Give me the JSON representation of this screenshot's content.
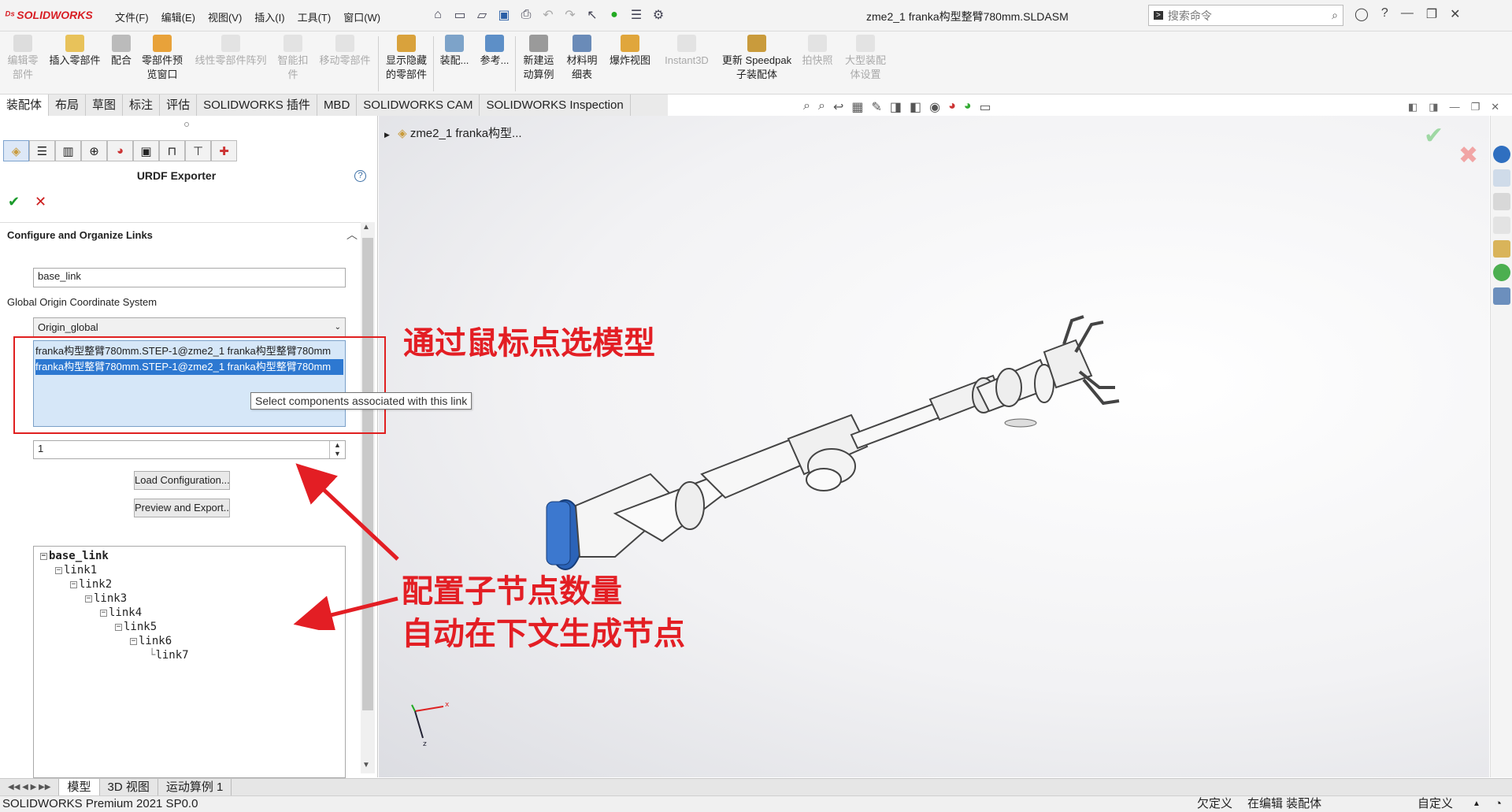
{
  "app": {
    "logo_text": "SOLIDWORKS"
  },
  "menus": [
    "文件(F)",
    "编辑(E)",
    "视图(V)",
    "插入(I)",
    "工具(T)",
    "窗口(W)"
  ],
  "window": {
    "title": "zme2_1 franka构型整臂780mm.SLDASM"
  },
  "search": {
    "placeholder": "搜索命令"
  },
  "commands": [
    {
      "label": "编辑零\n部件",
      "enabled": false
    },
    {
      "label": "插入零部件",
      "enabled": true
    },
    {
      "label": "配合",
      "enabled": true
    },
    {
      "label": "零部件预\n览窗口",
      "enabled": true
    },
    {
      "label": "线性零部件阵列",
      "enabled": false
    },
    {
      "label": "智能扣\n件",
      "enabled": false
    },
    {
      "label": "移动零部件",
      "enabled": false
    },
    {
      "label": "显示隐藏\n的零部件",
      "enabled": true
    },
    {
      "label": "装配...",
      "enabled": true
    },
    {
      "label": "参考...",
      "enabled": true
    },
    {
      "label": "新建运\n动算例",
      "enabled": true
    },
    {
      "label": "材料明\n细表",
      "enabled": true
    },
    {
      "label": "爆炸视图",
      "enabled": true
    },
    {
      "label": "Instant3D",
      "enabled": false
    },
    {
      "label": "更新 Speedpak\n子装配体",
      "enabled": true
    },
    {
      "label": "拍快照",
      "enabled": false
    },
    {
      "label": "大型装配\n体设置",
      "enabled": false
    }
  ],
  "tabs": [
    "装配体",
    "布局",
    "草图",
    "标注",
    "评估",
    "SOLIDWORKS 插件",
    "MBD",
    "SOLIDWORKS CAM",
    "SOLIDWORKS Inspection"
  ],
  "active_tab": "装配体",
  "property_manager": {
    "title": "URDF Exporter",
    "section": "Configure and Organize Links",
    "link_name": "base_link",
    "coord_label": "Global Origin Coordinate System",
    "coord_value": "Origin_global",
    "components": [
      "franka构型整臂780mm.STEP-1@zme2_1 franka构型整臂780mm",
      "franka构型整臂780mm.STEP-1@zme2_1 franka构型整臂780mm"
    ],
    "tooltip": "Select components associated with this link",
    "child_count": "1",
    "load_button": "Load Configuration...",
    "preview_button": "Preview and Export..."
  },
  "link_tree": [
    "base_link",
    "link1",
    "link2",
    "link3",
    "link4",
    "link5",
    "link6",
    "link7"
  ],
  "feature_tree_root": "zme2_1 franka构型...",
  "annotations": {
    "select_model": "通过鼠标点选模型",
    "configure_children_1": "配置子节点数量",
    "configure_children_2": "自动在下文生成节点"
  },
  "bottom_tabs": [
    "模型",
    "3D 视图",
    "运动算例 1"
  ],
  "status": {
    "product": "SOLIDWORKS Premium 2021 SP0.0",
    "state1": "欠定义",
    "state2": "在编辑 装配体",
    "units": "自定义"
  },
  "colors": {
    "annotation_red": "#e31e24",
    "selection_blue": "#2d78d1",
    "brand_red": "#d81e24"
  }
}
